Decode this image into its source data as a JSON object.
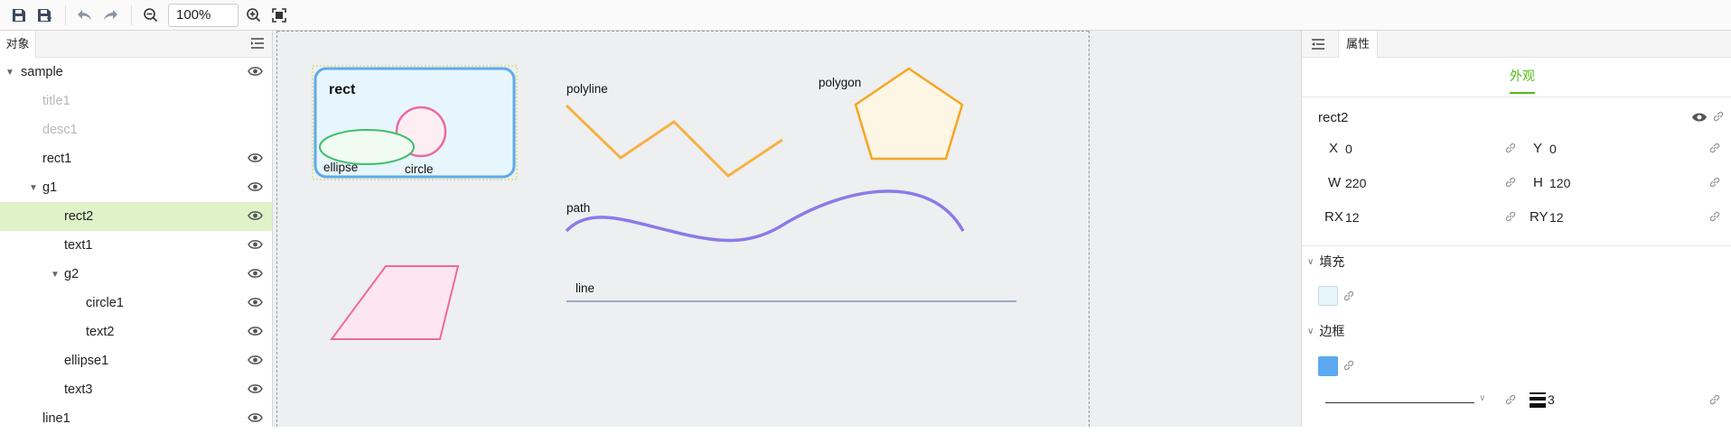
{
  "toolbar": {
    "zoom_value": "100%",
    "icons": [
      "save-icon",
      "save-as-icon",
      "undo-icon",
      "redo-icon",
      "zoom-out-icon",
      "zoom-in-icon",
      "fit-screen-icon"
    ]
  },
  "left_panel": {
    "tab_label": "对象",
    "tree": [
      {
        "label": "sample",
        "indent": 0,
        "caret": "▼",
        "eye": true,
        "dim": false,
        "selected": false
      },
      {
        "label": "title1",
        "indent": 1,
        "caret": "",
        "eye": false,
        "dim": true,
        "selected": false
      },
      {
        "label": "desc1",
        "indent": 1,
        "caret": "",
        "eye": false,
        "dim": true,
        "selected": false
      },
      {
        "label": "rect1",
        "indent": 1,
        "caret": "",
        "eye": true,
        "dim": false,
        "selected": false
      },
      {
        "label": "g1",
        "indent": 1,
        "caret": "▼",
        "eye": true,
        "dim": false,
        "selected": false
      },
      {
        "label": "rect2",
        "indent": 2,
        "caret": "",
        "eye": true,
        "dim": false,
        "selected": true
      },
      {
        "label": "text1",
        "indent": 2,
        "caret": "",
        "eye": true,
        "dim": false,
        "selected": false
      },
      {
        "label": "g2",
        "indent": 2,
        "caret": "▼",
        "eye": true,
        "dim": false,
        "selected": false
      },
      {
        "label": "circle1",
        "indent": 3,
        "caret": "",
        "eye": true,
        "dim": false,
        "selected": false
      },
      {
        "label": "text2",
        "indent": 3,
        "caret": "",
        "eye": true,
        "dim": false,
        "selected": false
      },
      {
        "label": "ellipse1",
        "indent": 2,
        "caret": "",
        "eye": true,
        "dim": false,
        "selected": false
      },
      {
        "label": "text3",
        "indent": 2,
        "caret": "",
        "eye": true,
        "dim": false,
        "selected": false
      },
      {
        "label": "line1",
        "indent": 1,
        "caret": "",
        "eye": true,
        "dim": false,
        "selected": false
      }
    ]
  },
  "canvas": {
    "rect_label": "rect",
    "ellipse_label": "ellipse",
    "circle_label": "circle",
    "polyline_label": "polyline",
    "polygon_label": "polygon",
    "path_label": "path",
    "line_label": "line",
    "colors": {
      "rect_fill": "#e6f6fc",
      "rect_stroke": "#5fa9ec",
      "circle_fill": "#fdeef4",
      "circle_stroke": "#ec6aa0",
      "ellipse_fill": "#f0fbf2",
      "ellipse_stroke": "#3fbf6a",
      "polyline_stroke": "#f7b142",
      "polygon_fill": "#fef6e4",
      "polygon_stroke": "#f5a623",
      "path_stroke": "#8b7ae8",
      "line_stroke": "#9aaac4",
      "parallelogram_fill": "#fde6f0",
      "parallelogram_stroke": "#ef6a9a"
    }
  },
  "right_panel": {
    "tab_label": "属性",
    "sub_tab_label": "外观",
    "object_name": "rect2",
    "props": {
      "x_label": "X",
      "x_value": "0",
      "y_label": "Y",
      "y_value": "0",
      "w_label": "W",
      "w_value": "220",
      "h_label": "H",
      "h_value": "120",
      "rx_label": "RX",
      "rx_value": "12",
      "ry_label": "RY",
      "ry_value": "12"
    },
    "fill_section": "填充",
    "fill_color": "#e8f6fc",
    "stroke_section": "边框",
    "stroke_color": "#5aa9f0",
    "stroke_width": "3"
  }
}
